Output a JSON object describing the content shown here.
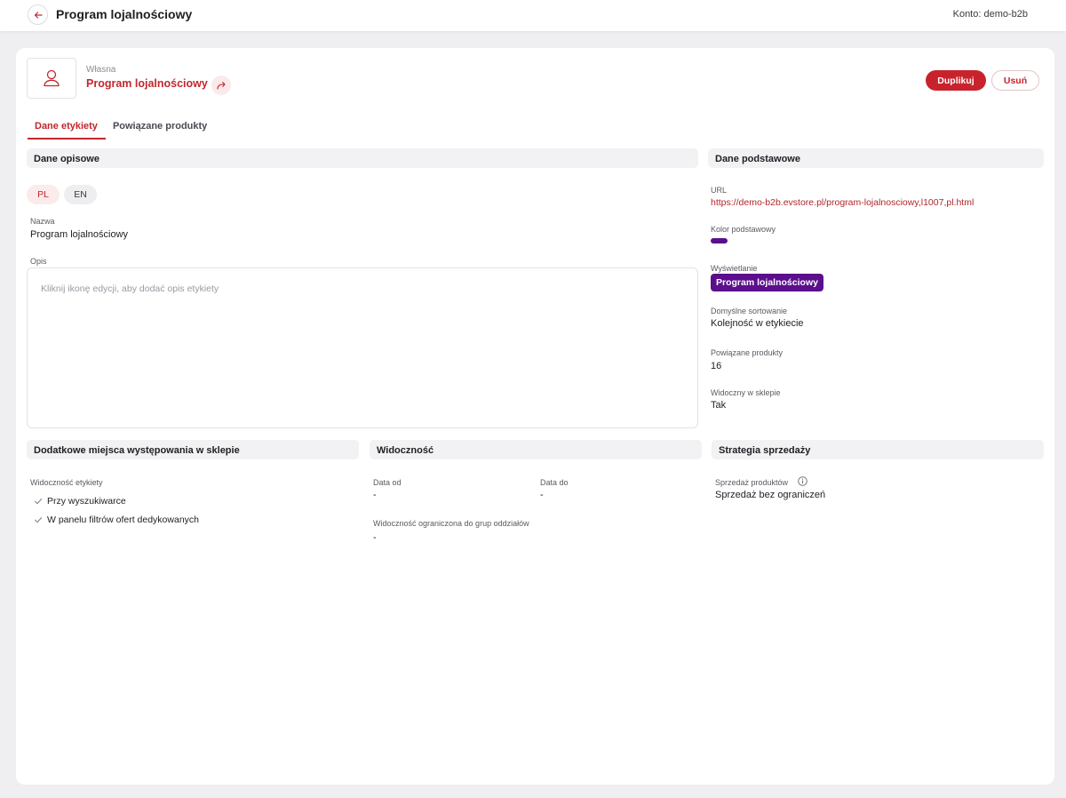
{
  "header": {
    "title": "Program lojalnościowy",
    "account": "Konto: demo-b2b"
  },
  "label": {
    "kind": "Własna",
    "name": "Program lojalnościowy",
    "icon": "user-icon"
  },
  "actions": {
    "duplicate": "Duplikuj",
    "delete": "Usuń"
  },
  "tabs": [
    {
      "label": "Dane etykiety",
      "active": true
    },
    {
      "label": "Powiązane produkty",
      "active": false
    }
  ],
  "descriptive": {
    "title": "Dane opisowe",
    "languages": [
      {
        "code": "PL",
        "active": true
      },
      {
        "code": "EN",
        "active": false
      }
    ],
    "name_label": "Nazwa",
    "name_value": "Program lojalnościowy",
    "desc_label": "Opis",
    "desc_placeholder": "Kliknij ikonę edycji, aby dodać opis etykiety"
  },
  "basic": {
    "title": "Dane podstawowe",
    "url_label": "URL",
    "url_value": "https://demo-b2b.evstore.pl/program-lojalnosciowy,l1007,pl.html",
    "color_label": "Kolor podstawowy",
    "color_value": "#5b0f8c",
    "display_label": "Wyświetlanie",
    "display_badge": "Program lojalnościowy",
    "sort_label": "Domyślne sortowanie",
    "sort_value": "Kolejność w etykiecie",
    "products_label": "Powiązane produkty",
    "products_value": "16",
    "visible_label": "Widoczny w sklepie",
    "visible_value": "Tak"
  },
  "placements": {
    "title": "Dodatkowe miejsca występowania w sklepie",
    "visibility_label": "Widoczność etykiety",
    "items": [
      "Przy wyszukiwarce",
      "W panelu filtrów ofert dedykowanych"
    ]
  },
  "visibility": {
    "title": "Widoczność",
    "date_from_label": "Data od",
    "date_from_value": "-",
    "date_to_label": "Data do",
    "date_to_value": "-",
    "groups_label": "Widoczność ograniczona do grup oddziałów",
    "groups_value": "-"
  },
  "sales": {
    "title": "Strategia sprzedaży",
    "label": "Sprzedaż produktów",
    "value": "Sprzedaż bez ograniczeń"
  },
  "colors": {
    "accent": "#c8232c",
    "brand_purple": "#5b0f8c"
  }
}
